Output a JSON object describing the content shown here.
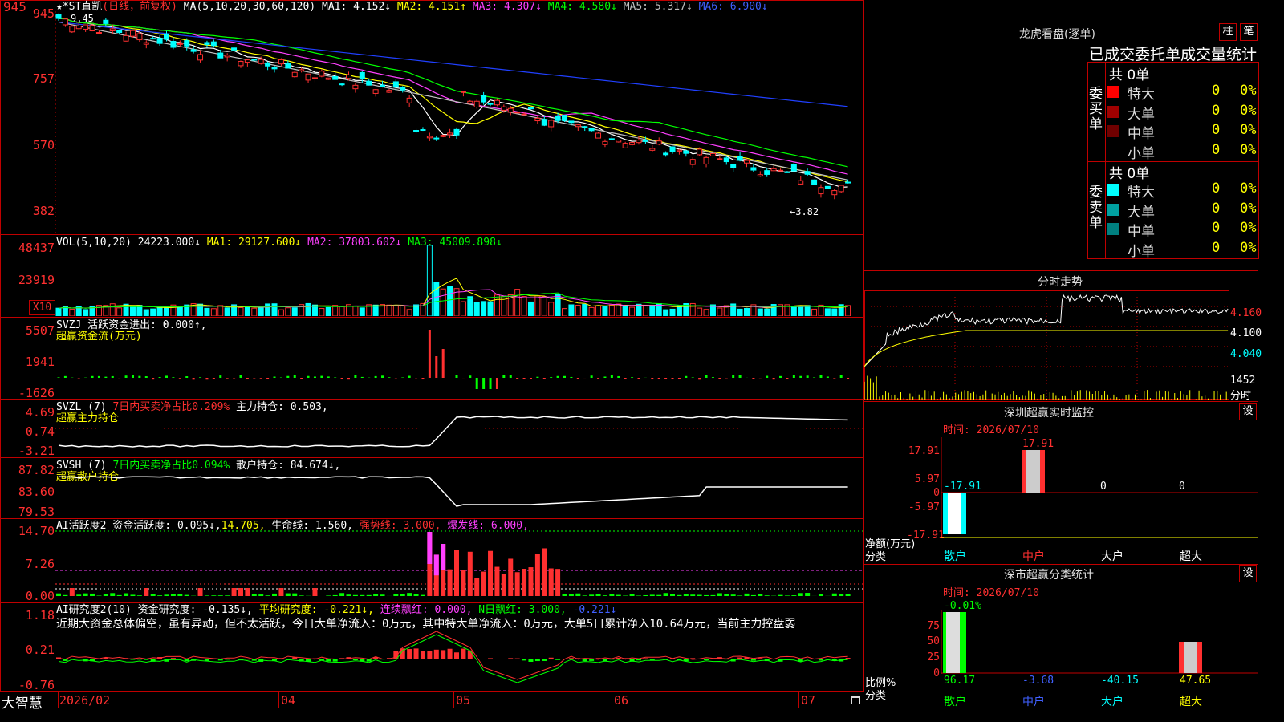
{
  "colors": {
    "up": "#ff3030",
    "down": "#00ffff",
    "grid": "#c00000",
    "ma1": "#ffffff",
    "ma2": "#ffff00",
    "ma3": "#ff40ff",
    "ma4": "#00ff00",
    "ma5": "#c0c0c0",
    "ma6": "#2040ff"
  },
  "title": {
    "code": "945",
    "stock": "★*ST直凯",
    "period": "(日线，前复权)",
    "ma_label": "MA(5,10,20,30,60,120)",
    "ma1": "MA1: 4.152↓",
    "ma2": "MA2: 4.151↑",
    "ma3": "MA3: 4.307↓",
    "ma4": "MA4: 4.580↓",
    "ma5": "MA5: 5.317↓",
    "ma6": "MA6: 6.900↓",
    "high_mark": "9.45",
    "low_mark": "←3.82"
  },
  "price_axis": [
    "945",
    "757",
    "570",
    "382"
  ],
  "vol": {
    "header": "VOL(5,10,20)",
    "val": "24223.000↓",
    "ma1": "MA1: 29127.600↓",
    "ma2": "MA2: 37803.602↓",
    "ma3": "MA3: 45009.898↓",
    "axis": [
      "48437",
      "23919"
    ],
    "unit": "X10"
  },
  "svzj": {
    "header": "SVZJ  活跃资金进出: 0.000↑,",
    "sub": "超赢资金流(万元)",
    "axis": [
      "5507",
      "1941",
      "-1626"
    ]
  },
  "svzl": {
    "header": "SVZL (7)",
    "txt1": "7日内买卖净占比0.209%",
    "txt2": "主力持仓: 0.503,",
    "sub": "超赢主力持仓",
    "axis": [
      "4.69",
      "0.74",
      "-3.21"
    ]
  },
  "svsh": {
    "header": "SVSH (7)",
    "txt1": "7日内买卖净占比0.094%",
    "txt2": "散户持仓: 84.674↓,",
    "sub": "超赢散户持仓",
    "axis": [
      "87.82",
      "83.60",
      "79.53"
    ]
  },
  "ai1": {
    "header": "AI活跃度2 资金活跃度: 0.095↓,",
    "v1": "14.705,",
    "v2": "生命线: 1.560,",
    "v3": "强势线: 3.000,",
    "v4": "爆发线: 6.000,",
    "axis": [
      "14.70",
      "7.26",
      "0.00"
    ]
  },
  "ai2": {
    "header": "AI研究度2(10) 资金研究度: -0.135↓,",
    "v1": "平均研究度: -0.221↓,",
    "v2": "连续飘红: 0.000,",
    "v3": "N日飘红: 3.000,",
    "v4": "-0.221↓",
    "comment": "近期大资金总体偏空，虽有异动，但不太活跃，今日大单净流入：0万元，其中特大单净流入：0万元，大单5日累计净入10.64万元，当前主力控盘弱",
    "axis": [
      "1.18",
      "0.21",
      "-0.76"
    ]
  },
  "bottom": {
    "brand": "大智慧",
    "dates": [
      "2026/02",
      "04",
      "05",
      "06",
      "07"
    ]
  },
  "lhb": {
    "title": "龙虎看盘(逐单)",
    "btn1": "柱",
    "btn2": "笔",
    "subtitle": "已成交委托单成交量统计",
    "buy_label": "委买单",
    "sell_label": "委卖单",
    "buy_total": "共 0单",
    "sell_total": "共 0单",
    "buy_rows": [
      {
        "name": "特大",
        "count": "0",
        "pct": "0%",
        "color": "#ff0000"
      },
      {
        "name": "大单",
        "count": "0",
        "pct": "0%",
        "color": "#a00000"
      },
      {
        "name": "中单",
        "count": "0",
        "pct": "0%",
        "color": "#700000"
      },
      {
        "name": "小单",
        "count": "0",
        "pct": "0%",
        "color": "#000000"
      }
    ],
    "sell_rows": [
      {
        "name": "特大",
        "count": "0",
        "pct": "0%",
        "color": "#00ffff"
      },
      {
        "name": "大单",
        "count": "0",
        "pct": "0%",
        "color": "#00a0a0"
      },
      {
        "name": "中单",
        "count": "0",
        "pct": "0%",
        "color": "#008080"
      },
      {
        "name": "小单",
        "count": "0",
        "pct": "0%",
        "color": "#000000"
      }
    ]
  },
  "intraday": {
    "title": "分时走势",
    "axis": [
      "4.160",
      "4.100",
      "4.040"
    ],
    "vol_axis": "1452",
    "vol_unit": "分时"
  },
  "monitor": {
    "title": "深圳超赢实时监控",
    "btn": "设",
    "time": "时间: 2026/07/10",
    "axis": [
      "17.91",
      "5.97",
      "0",
      "-5.97",
      "-17.91"
    ],
    "labels": [
      "-17.91",
      "17.91",
      "0",
      "0"
    ],
    "ylabel": "净额(万元)",
    "xlabel": "分类",
    "cats": [
      "散户",
      "中户",
      "大户",
      "超大"
    ],
    "cat_colors": [
      "#00ffff",
      "#ff3030",
      "#ffffff",
      "#ffffff"
    ]
  },
  "classstat": {
    "title": "深市超赢分类统计",
    "btn": "设",
    "time": "时间: 2026/07/10",
    "top_label": "-0.01%",
    "axis": [
      "75",
      "50",
      "25",
      "0"
    ],
    "values": [
      "96.17",
      "-3.68",
      "-40.15",
      "47.65"
    ],
    "val_colors": [
      "#00ff00",
      "#4060ff",
      "#00ffff",
      "#ffff00"
    ],
    "ylabel": "比例%",
    "xlabel": "分类",
    "cats": [
      "散户",
      "中户",
      "大户",
      "超大"
    ],
    "cat_colors": [
      "#00ff00",
      "#4060ff",
      "#00ffff",
      "#ffff00"
    ]
  }
}
